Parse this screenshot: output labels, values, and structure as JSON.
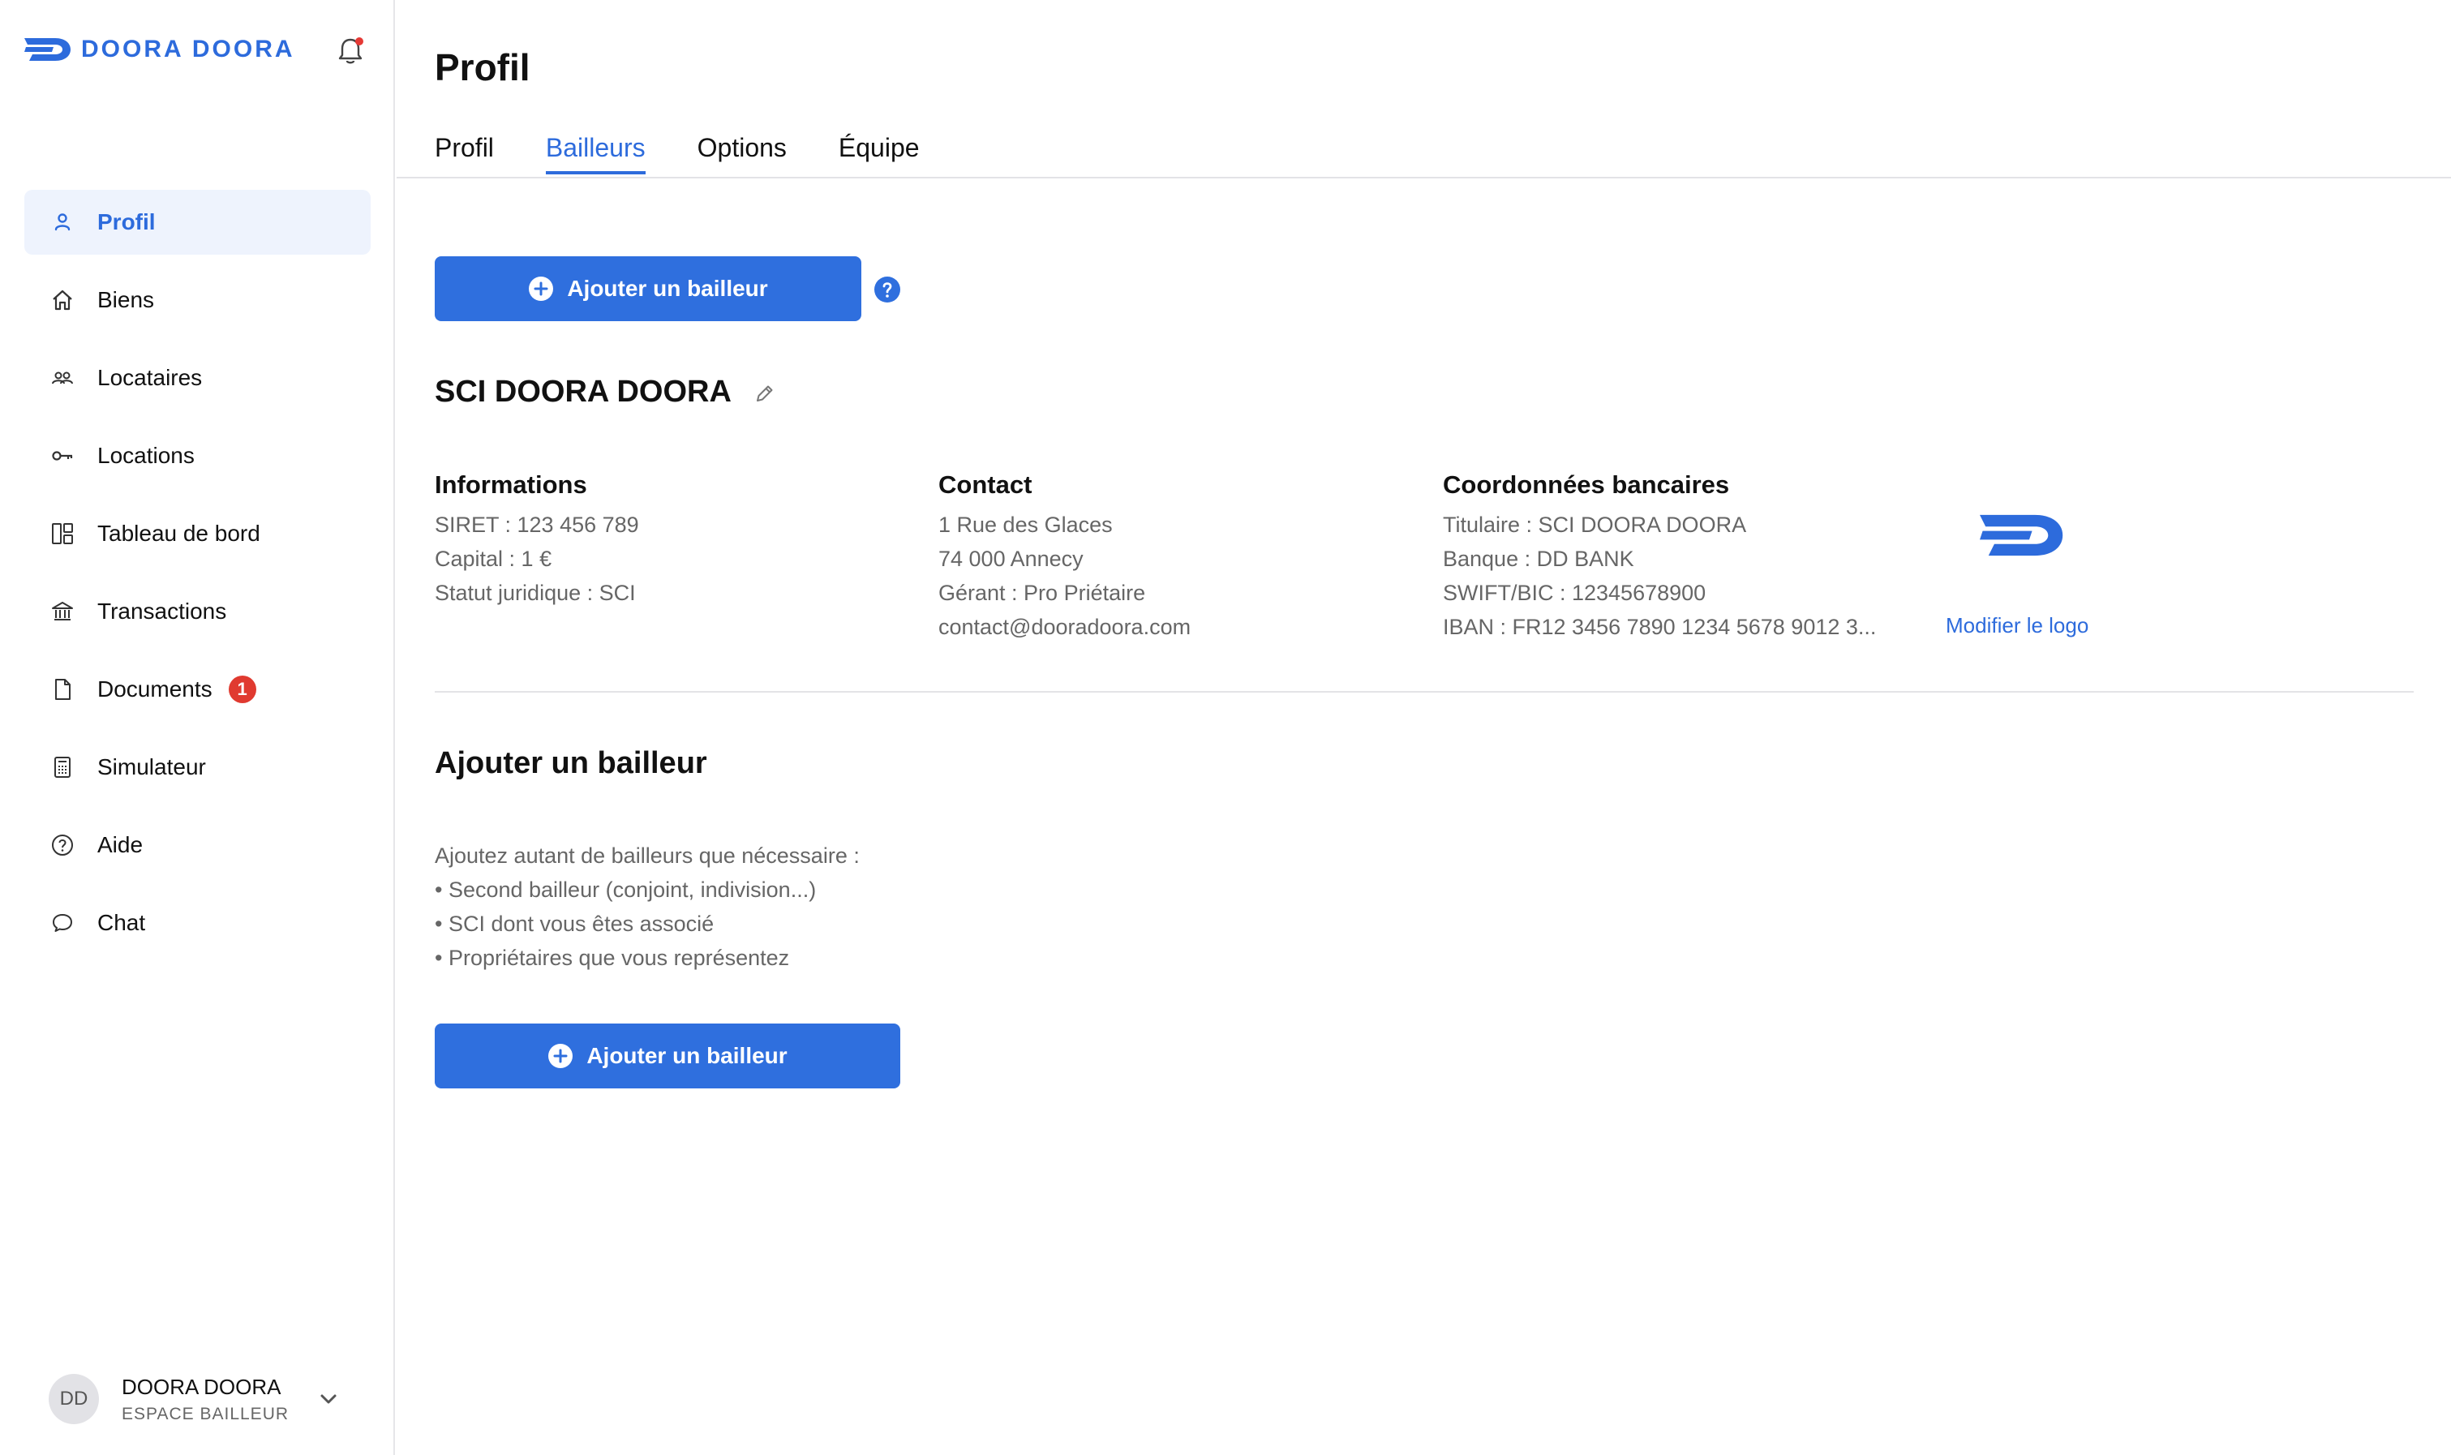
{
  "brand": {
    "name": "DOORA DOORA",
    "color": "#2d6bdc"
  },
  "sidebar": {
    "items": [
      {
        "label": "Profil",
        "icon": "user-icon",
        "active": true
      },
      {
        "label": "Biens",
        "icon": "home-icon"
      },
      {
        "label": "Locataires",
        "icon": "people-icon"
      },
      {
        "label": "Locations",
        "icon": "key-icon"
      },
      {
        "label": "Tableau de bord",
        "icon": "dashboard-icon"
      },
      {
        "label": "Transactions",
        "icon": "bank-icon"
      },
      {
        "label": "Documents",
        "icon": "document-icon",
        "badge": "1"
      },
      {
        "label": "Simulateur",
        "icon": "calculator-icon"
      },
      {
        "label": "Aide",
        "icon": "help-circle-icon"
      },
      {
        "label": "Chat",
        "icon": "chat-bubble-icon"
      }
    ]
  },
  "account": {
    "initials": "DD",
    "name": "DOORA DOORA",
    "role": "ESPACE BAILLEUR"
  },
  "header": {
    "title": "Profil",
    "tabs": [
      {
        "label": "Profil"
      },
      {
        "label": "Bailleurs",
        "active": true
      },
      {
        "label": "Options"
      },
      {
        "label": "Équipe"
      }
    ]
  },
  "main": {
    "add_button_label": "Ajouter un bailleur",
    "entity_name": "SCI DOORA DOORA",
    "informations": {
      "title": "Informations",
      "lines": [
        "SIRET : 123 456 789",
        "Capital : 1 €",
        "Statut juridique : SCI"
      ]
    },
    "contact": {
      "title": "Contact",
      "lines": [
        "1 Rue des Glaces",
        "74 000 Annecy",
        "Gérant : Pro Priétaire",
        "contact@dooradoora.com"
      ]
    },
    "bank": {
      "title": "Coordonnées bancaires",
      "lines": [
        "Titulaire : SCI DOORA DOORA",
        "Banque : DD BANK",
        "SWIFT/BIC : 12345678900",
        "IBAN : FR12 3456 7890 1234 5678 9012 3..."
      ]
    },
    "logo_link": "Modifier le logo",
    "add_section": {
      "title": "Ajouter un bailleur",
      "lines": [
        "Ajoutez autant de bailleurs que nécessaire :",
        "• Second bailleur (conjoint, indivision...)",
        "• SCI dont vous êtes associé",
        "• Propriétaires que vous représentez"
      ],
      "button_label": "Ajouter un bailleur"
    }
  },
  "colors": {
    "accent": "#2f6fde",
    "badge": "#e03a30",
    "active_bg": "#eef3fd"
  }
}
